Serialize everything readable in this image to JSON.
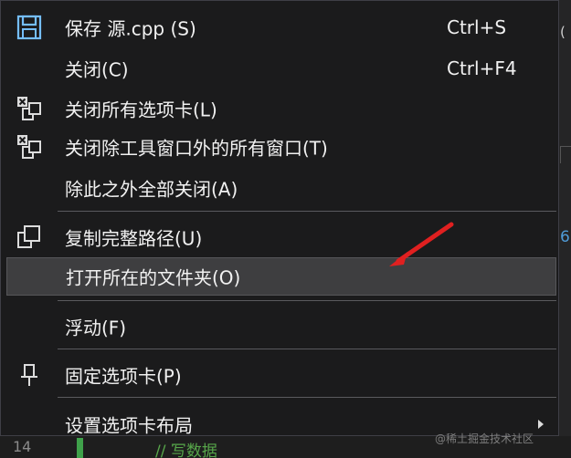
{
  "menu": {
    "items": [
      {
        "label": "保存 源.cpp (S)",
        "shortcut": "Ctrl+S",
        "icon": "save-icon"
      },
      {
        "label": "关闭(C)",
        "shortcut": "Ctrl+F4",
        "icon": ""
      },
      {
        "label": "关闭所有选项卡(L)",
        "shortcut": "",
        "icon": "close-all-tabs-icon"
      },
      {
        "label": "关闭除工具窗口外的所有窗口(T)",
        "shortcut": "",
        "icon": "close-all-documents-icon"
      },
      {
        "label": "除此之外全部关闭(A)",
        "shortcut": "",
        "icon": ""
      },
      {
        "label": "复制完整路径(U)",
        "shortcut": "",
        "icon": "copy-path-icon"
      },
      {
        "label": "打开所在的文件夹(O)",
        "shortcut": "",
        "icon": "",
        "highlighted": true
      },
      {
        "label": "浮动(F)",
        "shortcut": "",
        "icon": ""
      },
      {
        "label": "固定选项卡(P)",
        "shortcut": "",
        "icon": "pin-icon"
      },
      {
        "label": "设置选项卡布局",
        "shortcut": "",
        "icon": "",
        "has_submenu": true
      }
    ]
  },
  "background": {
    "line_number": "14",
    "code_text": "// 写数据",
    "right_glyph_top": "(",
    "right_glyph_mid": "6"
  },
  "watermark": "@稀土掘金技术社区",
  "colors": {
    "menu_bg": "#1b1b1c",
    "menu_text": "#f1f1f1",
    "highlight_bg": "#3e3e40",
    "save_icon_blue": "#75beff",
    "annotation_red": "#e02020"
  }
}
